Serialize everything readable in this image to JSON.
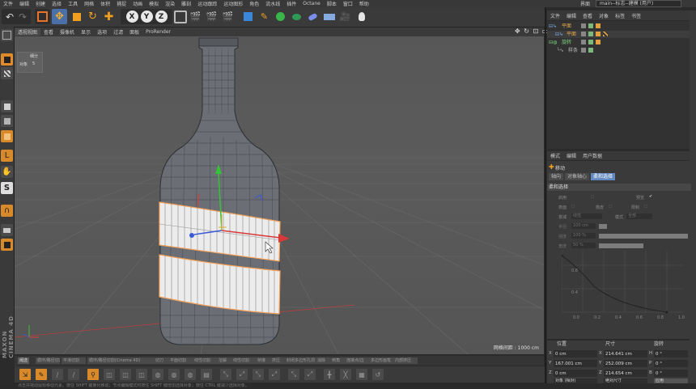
{
  "menubar": {
    "items": [
      "文件",
      "编辑",
      "创建",
      "选择",
      "工具",
      "网格",
      "体积",
      "捕捉",
      "动画",
      "模拟",
      "渲染",
      "雕刻",
      "运动跟踪",
      "运动图形",
      "角色",
      "流水线",
      "插件",
      "Octane",
      "脚本",
      "窗口",
      "帮助"
    ],
    "layout_label": "界面",
    "layout_value": "main--标志--建模 (用户)"
  },
  "toolbar": {
    "undo_icon": "undo-icon",
    "axis_x": "X",
    "axis_y": "Y",
    "axis_z": "Z"
  },
  "viewport": {
    "menu": [
      "透视视图",
      "查看",
      "摄像机",
      "显示",
      "选项",
      "过滤",
      "面板",
      "ProRender"
    ],
    "nav_icons": "✥ ↻ ⊡ ▭",
    "info_title": "细分",
    "info_key": "对象",
    "info_value": "5",
    "grid_note": "网格间距 : 1000 cm"
  },
  "viewport_strip": [
    "阈选",
    "循环/路径切割",
    "平滑切割",
    "循环/路径切割(Cinema 4D)",
    "切刀",
    "平面切割",
    "线性切割",
    "溶解",
    "线性切割",
    "桥接",
    "挤压",
    "封闭多边形孔洞",
    "消除",
    "倒角",
    "连接点/边",
    "多边形画笔",
    "内部挤压"
  ],
  "status": {
    "text": "点击并拖动鼠标移动元素。按住 SHIFT 键量化移动；节点编辑模式时按住 SHIFT 键增加选择对象；按住 CTRL 键减少选择对象。"
  },
  "object_panel": {
    "menu": [
      "文件",
      "编辑",
      "查看",
      "对象",
      "标签",
      "书签"
    ],
    "objects": [
      {
        "name": "平面",
        "name_color": "#e6a84a"
      },
      {
        "name": "平面",
        "name_color": "#e6a84a"
      },
      {
        "name": "旋转",
        "name_color": "#7fd37f"
      },
      {
        "name": "样条",
        "name_color": "#bdbdbd"
      }
    ]
  },
  "attributes": {
    "menu": [
      "模式",
      "编辑",
      "用户数据"
    ],
    "title": "移动",
    "tabs": [
      "轴向",
      "对象轴心",
      "柔和选择"
    ],
    "section": "柔和选择",
    "props": {
      "enable": "启用",
      "preview": "预览",
      "surface": "表面",
      "rubber": "橡皮",
      "restrict": "限制",
      "mode": "模式",
      "mode_value": "全部",
      "falloff": "衰减",
      "falloff_value": "线性",
      "radius": "半径",
      "radius_value": "100 cm",
      "strength": "强度",
      "strength_value": "100 %",
      "width": "宽度",
      "width_value": "50 %"
    },
    "curve": {
      "y_top": "0.8",
      "y_mid": "0.4",
      "x_ticks": [
        "0.0",
        "0.2",
        "0.4",
        "0.6",
        "0.8",
        "1.0"
      ]
    }
  },
  "coordinates": {
    "headers": [
      "位置",
      "尺寸",
      "旋转"
    ],
    "rows": [
      {
        "axis": "X",
        "pos": "0 cm",
        "size": "214.641 cm",
        "rot_axis": "H",
        "rot": "0 °"
      },
      {
        "axis": "Y",
        "pos": "167.001 cm",
        "size": "252.009 cm",
        "rot_axis": "P",
        "rot": "0 °"
      },
      {
        "axis": "Z",
        "pos": "0 cm",
        "size": "214.654 cm",
        "rot_axis": "B",
        "rot": "0 °"
      }
    ],
    "mode_left": "对象 (相对)",
    "mode_mid": "绝对尺寸",
    "apply": "应用"
  },
  "brand": "MAXON CINEMA 4D"
}
